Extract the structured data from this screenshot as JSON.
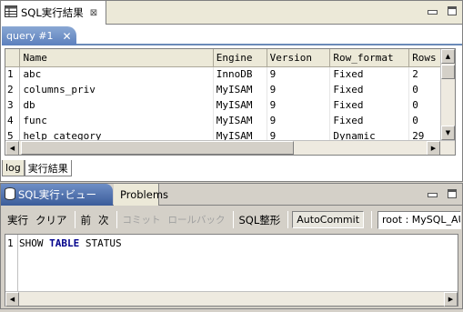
{
  "top_view": {
    "tab_title": "SQL実行結果",
    "close_glyph": "⊠",
    "query_tab_label": "query #1",
    "query_tab_close": "✕",
    "columns": [
      "Name",
      "Engine",
      "Version",
      "Row_format",
      "Rows"
    ],
    "rows": [
      {
        "num": "1",
        "cells": [
          "abc",
          "InnoDB",
          "9",
          "Fixed",
          "2"
        ]
      },
      {
        "num": "2",
        "cells": [
          "columns_priv",
          "MyISAM",
          "9",
          "Fixed",
          "0"
        ]
      },
      {
        "num": "3",
        "cells": [
          "db",
          "MyISAM",
          "9",
          "Fixed",
          "0"
        ]
      },
      {
        "num": "4",
        "cells": [
          "func",
          "MyISAM",
          "9",
          "Fixed",
          "0"
        ]
      },
      {
        "num": "5",
        "cells": [
          "help_category",
          "MyISAM",
          "9",
          "Dynamic",
          "29"
        ]
      }
    ],
    "bottom_tabs": [
      "log",
      "実行結果"
    ]
  },
  "bottom_view": {
    "tab_active": "SQL実行･ビュー",
    "tab_inactive": "Problems",
    "toolbar": {
      "execute": "実行",
      "clear": "クリア",
      "prev": "前",
      "next": "次",
      "commit": "コミット",
      "rollback": "ロールバック",
      "format": "SQL整形",
      "autocommit": "AutoCommit",
      "connection": "root : MySQL_AUTO"
    },
    "editor": {
      "line_numbers": [
        "1"
      ],
      "tokens": [
        {
          "text": "SHOW ",
          "kw": false
        },
        {
          "text": "TABLE",
          "kw": true
        },
        {
          "text": " STATUS",
          "kw": false
        }
      ]
    }
  },
  "colors": {
    "accent": "#5c80bd",
    "keyword": "#00008b"
  }
}
